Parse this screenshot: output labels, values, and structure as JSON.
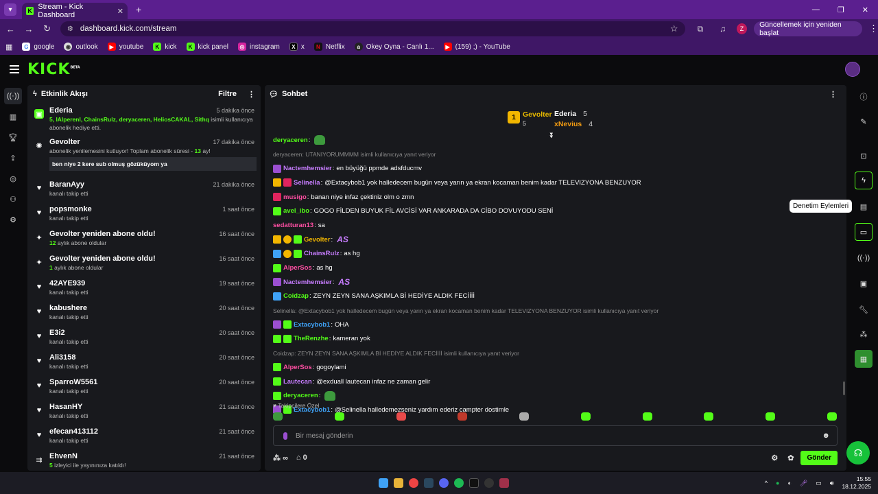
{
  "browser": {
    "tab_title": "Stream - Kick Dashboard",
    "url": "dashboard.kick.com/stream",
    "profile_initial": "Z",
    "update_label": "Güncellemek için yeniden başlat"
  },
  "bookmarks": [
    "google",
    "outlook",
    "youtube",
    "kick",
    "kick panel",
    "instagram",
    "x",
    "Netflix",
    "Okey Oyna - Canlı 1...",
    "(159) ;) - YouTube"
  ],
  "feed": {
    "title": "Etkinlik Akışı",
    "filter_label": "Filtre",
    "items": [
      {
        "name": "Ederia",
        "time": "5 dakika önce",
        "sub_highlight": "5, lAlperenl, ChainsRulz, deryaceren, HeliosCAKAL, Sithq",
        "sub": "isimli kullanıcıya abonelik hediye etti.",
        "icon": "gift-icon"
      },
      {
        "name": "Gevolter",
        "time": "17 dakika önce",
        "sub": "abonelik yenilemesini kutluyor! Toplam abonelik süresi - ",
        "sub_highlight": "13",
        "sub_end": "ay!",
        "message": "ben niye 2 kere sub olmuş gözüküyom ya",
        "icon": "confetti-icon"
      },
      {
        "name": "BaranAyy",
        "time": "21 dakika önce",
        "sub": "kanalı takip etti",
        "icon": "heart-icon"
      },
      {
        "name": "popsmonke",
        "time": "1 saat önce",
        "sub": "kanalı takip etti",
        "icon": "heart-icon"
      },
      {
        "name": "Gevolter yeniden abone oldu!",
        "time": "16 saat önce",
        "sub_highlight": "12",
        "sub": "aylık abone oldular",
        "icon": "sparkle-icon"
      },
      {
        "name": "Gevolter yeniden abone oldu!",
        "time": "16 saat önce",
        "sub_highlight": "1",
        "sub": "aylık abone oldular",
        "icon": "sparkle-icon"
      },
      {
        "name": "42AYE939",
        "time": "19 saat önce",
        "sub": "kanalı takip etti",
        "icon": "heart-icon"
      },
      {
        "name": "kabushere",
        "time": "20 saat önce",
        "sub": "kanalı takip etti",
        "icon": "heart-icon"
      },
      {
        "name": "E3i2",
        "time": "20 saat önce",
        "sub": "kanalı takip etti",
        "icon": "heart-icon"
      },
      {
        "name": "Ali3158",
        "time": "20 saat önce",
        "sub": "kanalı takip etti",
        "icon": "heart-icon"
      },
      {
        "name": "SparroW5561",
        "time": "20 saat önce",
        "sub": "kanalı takip etti",
        "icon": "heart-icon"
      },
      {
        "name": "HasanHY",
        "time": "21 saat önce",
        "sub": "kanalı takip etti",
        "icon": "heart-icon"
      },
      {
        "name": "efecan413112",
        "time": "21 saat önce",
        "sub": "kanalı takip etti",
        "icon": "heart-icon"
      },
      {
        "name": "EhvenN",
        "time": "21 saat önce",
        "sub_highlight": "5",
        "sub": "izleyici ile yayınınıza katıldı!",
        "icon": "raid-icon"
      }
    ]
  },
  "chat": {
    "title": "Sohbet",
    "leaderboard": {
      "first": {
        "name": "Gevolter",
        "count": "5",
        "rank": "1"
      },
      "second": {
        "name": "Ederia",
        "count": "5"
      },
      "third": {
        "name": "xNevius",
        "count": "4"
      }
    },
    "messages": [
      {
        "user": "deryaceren",
        "color": "#53fc18",
        "text": "",
        "emote": true,
        "badges": []
      },
      {
        "reply": "deryaceren: UTANIYORUMMMM isimli kullanıcıya yanıt veriyor"
      },
      {
        "user": "Nactemhemsier",
        "color": "#c77dff",
        "text": "en büyüğü ppmde adsfducmv",
        "badges": [
          "peach"
        ]
      },
      {
        "user": "Selinella",
        "color": "#c77dff",
        "text": "@Extacybob1 yok halledecem bugün veya yarın ya ekran kocaman benim kadar TELEVIZYONA BENZUYOR",
        "badges": [
          "crown",
          "red"
        ]
      },
      {
        "user": "musigo",
        "color": "#ff4fa3",
        "text": "banan niye infaz çektiniz olm o zmn",
        "badges": [
          "red"
        ]
      },
      {
        "user": "avel_ibo",
        "color": "#53fc18",
        "text": "GOGO FİLDEN BUYUK FİL AVCİSİ VAR ANKARADA DA CİBO DOVUYODU SENİ",
        "badges": [
          "green"
        ]
      },
      {
        "user": "sedatturan13",
        "color": "#ff4fa3",
        "text": "sa",
        "badges": []
      },
      {
        "user": "Gevolter",
        "color": "#f2b600",
        "text": "",
        "as": "AS",
        "badges": [
          "crown",
          "one",
          "gift"
        ]
      },
      {
        "user": "ChainsRulz",
        "color": "#c77dff",
        "text": "as hg",
        "badges": [
          "blue",
          "one",
          "gift"
        ]
      },
      {
        "user": "AlperSos",
        "color": "#ff4fa3",
        "text": "as hg",
        "badges": [
          "green"
        ]
      },
      {
        "user": "Nactemhemsier",
        "color": "#c77dff",
        "text": "",
        "as": "AS",
        "badges": [
          "peach"
        ]
      },
      {
        "user": "Coidzap",
        "color": "#53fc18",
        "text": "ZEYN ZEYN SANA AŞKIMLA Bİ HEDİYE ALDIK FECİİİİ",
        "badges": [
          "blue"
        ]
      },
      {
        "reply": "Selinella: @Extacybob1 yok halledecem bugün veya yarın ya ekran kocaman benim kadar TELEVIZYONA BENZUYOR isimli kullanıcıya yanıt veriyor"
      },
      {
        "user": "Extacybob1",
        "color": "#3fa2f7",
        "text": "OHA",
        "badges": [
          "peach",
          "gift"
        ]
      },
      {
        "user": "TheRenzhe",
        "color": "#53fc18",
        "text": "kameran yok",
        "badges": [
          "green",
          "gift"
        ]
      },
      {
        "reply": "Coidzap: ZEYN ZEYN SANA AŞKIMLA Bİ HEDİYE ALDIK FECİİİİ isimli kullanıcıya yanıt veriyor"
      },
      {
        "user": "AlperSos",
        "color": "#ff4fa3",
        "text": "gogoylami",
        "badges": [
          "green"
        ]
      },
      {
        "user": "Lautecan",
        "color": "#c77dff",
        "text": "@exduall lautecan infaz ne zaman gelir",
        "badges": [
          "gift"
        ]
      },
      {
        "user": "deryaceren",
        "color": "#53fc18",
        "text": "",
        "emote": true,
        "badges": [
          "green"
        ]
      },
      {
        "user": "Extacybob1",
        "color": "#3fa2f7",
        "text": "@Selinella halledemezseniz yardım ederiz campter dostimle",
        "badges": [
          "peach",
          "gift"
        ]
      }
    ],
    "followers_only": "Takipçilere Özel",
    "input_placeholder": "Bir mesaj gönderin",
    "infinity": "∞",
    "zero_count": "0",
    "send_label": "Gönder"
  },
  "tooltip": "Denetim Eylemleri",
  "clock": {
    "time": "15:55",
    "date": "18.12.2025"
  }
}
